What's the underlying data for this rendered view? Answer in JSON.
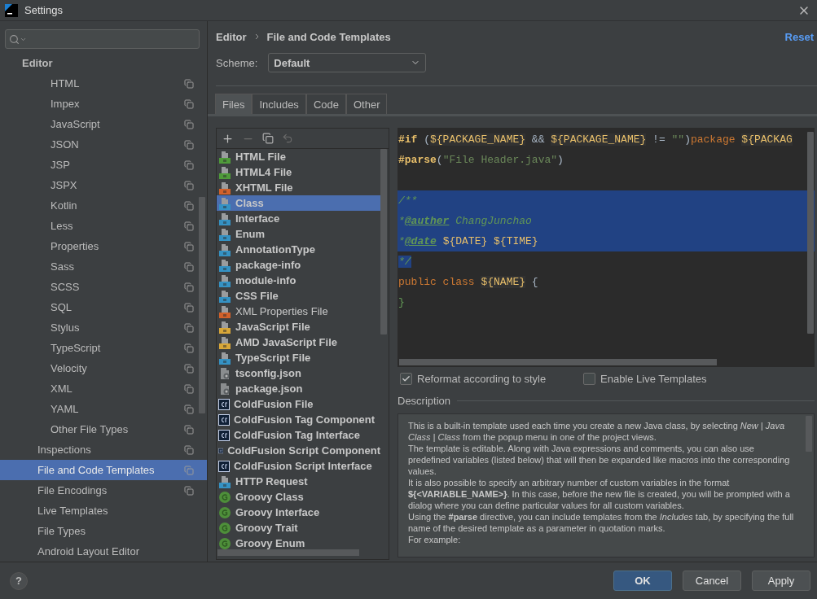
{
  "window": {
    "title": "Settings"
  },
  "sidebar": {
    "items": [
      {
        "label": "Editor",
        "selected": false,
        "children": [
          {
            "children": [
              {
                "label": "HTML",
                "selected": false,
                "scope_icon": true
              },
              {
                "label": "Impex",
                "selected": false,
                "scope_icon": true
              },
              {
                "label": "JavaScript",
                "selected": false,
                "scope_icon": true
              },
              {
                "label": "JSON",
                "selected": false,
                "scope_icon": true
              },
              {
                "label": "JSP",
                "selected": false,
                "scope_icon": true
              },
              {
                "label": "JSPX",
                "selected": false,
                "scope_icon": true
              },
              {
                "label": "Kotlin",
                "selected": false,
                "scope_icon": true
              },
              {
                "label": "Less",
                "selected": false,
                "scope_icon": true
              },
              {
                "label": "Properties",
                "selected": false,
                "scope_icon": true
              },
              {
                "label": "Sass",
                "selected": false,
                "scope_icon": true
              },
              {
                "label": "SCSS",
                "selected": false,
                "scope_icon": true
              },
              {
                "label": "SQL",
                "selected": false,
                "scope_icon": true
              },
              {
                "label": "Stylus",
                "selected": false,
                "scope_icon": true
              },
              {
                "label": "TypeScript",
                "selected": false,
                "scope_icon": true
              },
              {
                "label": "Velocity",
                "selected": false,
                "scope_icon": true
              },
              {
                "label": "XML",
                "selected": false,
                "scope_icon": true
              },
              {
                "label": "YAML",
                "selected": false,
                "scope_icon": true
              },
              {
                "label": "Other File Types",
                "selected": false,
                "scope_icon": true
              }
            ]
          },
          {
            "label": "Inspections",
            "selected": false,
            "scope_icon": true
          },
          {
            "label": "File and Code Templates",
            "selected": true,
            "scope_icon": true
          },
          {
            "label": "File Encodings",
            "selected": false,
            "scope_icon": true
          },
          {
            "label": "Live Templates",
            "selected": false,
            "scope_icon": false
          },
          {
            "label": "File Types",
            "selected": false,
            "scope_icon": false
          },
          {
            "label": "Android Layout Editor",
            "selected": false,
            "scope_icon": false
          }
        ]
      }
    ]
  },
  "breadcrumb": [
    "Editor",
    "File and Code Templates"
  ],
  "reset_link": "Reset",
  "scheme": {
    "label": "Scheme:",
    "value": "Default"
  },
  "tabs": [
    {
      "label": "Files",
      "selected": true
    },
    {
      "label": "Includes",
      "selected": false
    },
    {
      "label": "Code",
      "selected": false
    },
    {
      "label": "Other",
      "selected": false
    }
  ],
  "templates": [
    {
      "label": "HTML File",
      "kind": "html",
      "bold": true,
      "selected": false
    },
    {
      "label": "HTML4 File",
      "kind": "html",
      "bold": true,
      "selected": false
    },
    {
      "label": "XHTML File",
      "kind": "xhtml",
      "bold": true,
      "selected": false
    },
    {
      "label": "Class",
      "kind": "java",
      "bold": true,
      "selected": true
    },
    {
      "label": "Interface",
      "kind": "java",
      "bold": true,
      "selected": false
    },
    {
      "label": "Enum",
      "kind": "java",
      "bold": true,
      "selected": false
    },
    {
      "label": "AnnotationType",
      "kind": "java",
      "bold": true,
      "selected": false
    },
    {
      "label": "package-info",
      "kind": "java",
      "bold": true,
      "selected": false
    },
    {
      "label": "module-info",
      "kind": "java",
      "bold": true,
      "selected": false
    },
    {
      "label": "CSS File",
      "kind": "css",
      "bold": true,
      "selected": false
    },
    {
      "label": "XML Properties File",
      "kind": "xml",
      "bold": false,
      "selected": false
    },
    {
      "label": "JavaScript File",
      "kind": "js",
      "bold": true,
      "selected": false
    },
    {
      "label": "AMD JavaScript File",
      "kind": "js",
      "bold": true,
      "selected": false
    },
    {
      "label": "TypeScript File",
      "kind": "ts",
      "bold": true,
      "selected": false
    },
    {
      "label": "tsconfig.json",
      "kind": "json",
      "bold": true,
      "selected": false
    },
    {
      "label": "package.json",
      "kind": "json",
      "bold": true,
      "selected": false
    },
    {
      "label": "ColdFusion File",
      "kind": "cf",
      "bold": true,
      "selected": false
    },
    {
      "label": "ColdFusion Tag Component",
      "kind": "cf",
      "bold": true,
      "selected": false
    },
    {
      "label": "ColdFusion Tag Interface",
      "kind": "cf",
      "bold": true,
      "selected": false
    },
    {
      "label": "ColdFusion Script Component",
      "kind": "cf",
      "bold": true,
      "selected": false
    },
    {
      "label": "ColdFusion Script Interface",
      "kind": "cf",
      "bold": true,
      "selected": false
    },
    {
      "label": "HTTP Request",
      "kind": "api",
      "bold": true,
      "selected": false
    },
    {
      "label": "Groovy Class",
      "kind": "groovy",
      "bold": true,
      "selected": false
    },
    {
      "label": "Groovy Interface",
      "kind": "groovy",
      "bold": true,
      "selected": false
    },
    {
      "label": "Groovy Trait",
      "kind": "groovy",
      "bold": true,
      "selected": false
    },
    {
      "label": "Groovy Enum",
      "kind": "groovy",
      "bold": true,
      "selected": false
    }
  ],
  "code_lines": [
    {
      "selected": false,
      "tokens": [
        {
          "kind": "directive",
          "text": "#if"
        },
        {
          "kind": "plain",
          "text": " ("
        },
        {
          "kind": "var",
          "text": "${PACKAGE_NAME}"
        },
        {
          "kind": "plain",
          "text": " && "
        },
        {
          "kind": "var",
          "text": "${PACKAGE_NAME}"
        },
        {
          "kind": "plain",
          "text": " != "
        },
        {
          "kind": "string",
          "text": "\"\""
        },
        {
          "kind": "plain",
          "text": ")"
        },
        {
          "kind": "keyword",
          "text": "package "
        },
        {
          "kind": "var",
          "text": "${PACKAG"
        }
      ]
    },
    {
      "selected": false,
      "tokens": [
        {
          "kind": "directive",
          "text": "#parse"
        },
        {
          "kind": "plain",
          "text": "("
        },
        {
          "kind": "string",
          "text": "\"File Header.java\""
        },
        {
          "kind": "plain",
          "text": ")"
        }
      ]
    },
    {
      "selected": false
    },
    {
      "selected": true,
      "tokens": [
        {
          "kind": "comment",
          "text": "/**"
        }
      ]
    },
    {
      "selected": true,
      "tokens": [
        {
          "kind": "comment",
          "text": "*"
        },
        {
          "kind": "doctag",
          "text": "@auther"
        },
        {
          "kind": "comment",
          "text": " ChangJunchao"
        }
      ]
    },
    {
      "selected": true,
      "tokens": [
        {
          "kind": "comment",
          "text": "*"
        },
        {
          "kind": "doctag",
          "text": "@date"
        },
        {
          "kind": "var",
          "text": " ${DATE}"
        },
        {
          "kind": "var",
          "text": " ${TIME}"
        }
      ]
    },
    {
      "selected": true,
      "tokens": [
        {
          "kind": "comment",
          "text": "*/"
        }
      ]
    },
    {
      "selected": false,
      "tokens": [
        {
          "kind": "keyword",
          "text": "public class "
        },
        {
          "kind": "var",
          "text": "${NAME}"
        },
        {
          "kind": "plain",
          "text": " {"
        }
      ]
    },
    {
      "selected": false,
      "tokens": [
        {
          "kind": "brace",
          "text": "}"
        }
      ]
    }
  ],
  "options": [
    {
      "label": "Reformat according to style",
      "checked": true
    },
    {
      "label": "Enable Live Templates",
      "checked": false
    }
  ],
  "description": {
    "title": "Description",
    "paragraphs": [
      "This is a built-in template used each time you create a new Java class, by selecting *New | Java Class | Class* from the popup menu in one of the project views.",
      "The template is editable. Along with Java expressions and comments, you can also use predefined variables (listed below) that will then be expanded like macros into the corresponding values.",
      "It is also possible to specify an arbitrary number of custom variables in the format **${<VARIABLE_NAME>}**. In this case, before the new file is created, you will be prompted with a dialog where you can define particular values for all custom variables.",
      "Using the **#parse** directive, you can include templates from the *Includes* tab, by specifying the full name of the desired template as a parameter in quotation marks.",
      "For example:"
    ]
  },
  "help_button": "?",
  "buttons": [
    {
      "label": "OK",
      "primary": true
    },
    {
      "label": "Cancel",
      "primary": false
    },
    {
      "label": "Apply",
      "primary": false
    }
  ]
}
